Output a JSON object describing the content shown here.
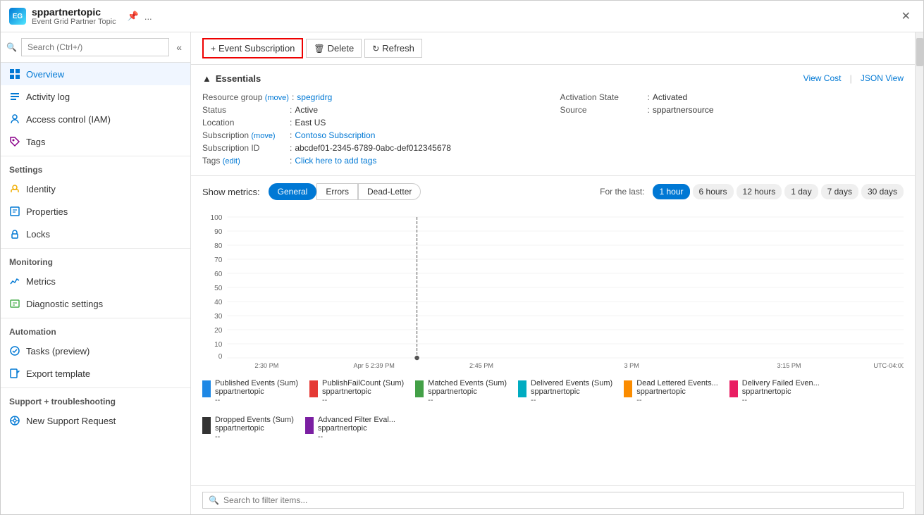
{
  "titleBar": {
    "title": "sppartnertopic",
    "subtitle": "Event Grid Partner Topic",
    "pinIcon": "📌",
    "moreIcon": "...",
    "closeIcon": "✕"
  },
  "sidebar": {
    "searchPlaceholder": "Search (Ctrl+/)",
    "collapseIcon": "«",
    "navItems": [
      {
        "id": "overview",
        "label": "Overview",
        "icon": "overview",
        "active": true
      },
      {
        "id": "activity-log",
        "label": "Activity log",
        "icon": "activity",
        "active": false
      },
      {
        "id": "access-control",
        "label": "Access control (IAM)",
        "icon": "access",
        "active": false
      },
      {
        "id": "tags",
        "label": "Tags",
        "icon": "tags",
        "active": false
      }
    ],
    "sections": [
      {
        "label": "Settings",
        "items": [
          {
            "id": "identity",
            "label": "Identity",
            "icon": "identity"
          },
          {
            "id": "properties",
            "label": "Properties",
            "icon": "properties"
          },
          {
            "id": "locks",
            "label": "Locks",
            "icon": "locks"
          }
        ]
      },
      {
        "label": "Monitoring",
        "items": [
          {
            "id": "metrics",
            "label": "Metrics",
            "icon": "metrics"
          },
          {
            "id": "diagnostic",
            "label": "Diagnostic settings",
            "icon": "diagnostic"
          }
        ]
      },
      {
        "label": "Automation",
        "items": [
          {
            "id": "tasks",
            "label": "Tasks (preview)",
            "icon": "tasks"
          },
          {
            "id": "export",
            "label": "Export template",
            "icon": "export"
          }
        ]
      },
      {
        "label": "Support + troubleshooting",
        "items": [
          {
            "id": "support",
            "label": "New Support Request",
            "icon": "support"
          }
        ]
      }
    ]
  },
  "toolbar": {
    "buttons": [
      {
        "id": "event-subscription",
        "label": "Event Subscription",
        "icon": "+",
        "primary": true
      },
      {
        "id": "delete",
        "label": "Delete",
        "icon": "🗑"
      },
      {
        "id": "refresh",
        "label": "Refresh",
        "icon": "↻"
      }
    ]
  },
  "essentials": {
    "title": "Essentials",
    "chevron": "▲",
    "links": [
      {
        "id": "view-cost",
        "label": "View Cost"
      },
      {
        "id": "json-view",
        "label": "JSON View"
      }
    ],
    "fields": [
      {
        "label": "Resource group",
        "subLabel": "(move)",
        "value": "spegridrg",
        "isLink": true,
        "col": 1
      },
      {
        "label": "Activation State",
        "value": "Activated",
        "isLink": false,
        "col": 2
      },
      {
        "label": "Status",
        "value": "Active",
        "isLink": false,
        "col": 1
      },
      {
        "label": "Source",
        "value": "sppartnersource",
        "isLink": false,
        "col": 2
      },
      {
        "label": "Location",
        "value": "East US",
        "isLink": false,
        "col": 1
      },
      {
        "label": "Subscription",
        "subLabel": "(move)",
        "value": "Contoso Subscription",
        "isLink": true,
        "col": 1
      },
      {
        "label": "Subscription ID",
        "value": "abcdef01-2345-6789-0abc-def012345678",
        "isLink": false,
        "col": 1
      },
      {
        "label": "Tags",
        "subLabel": "(edit)",
        "value": "Click here to add tags",
        "isLink": true,
        "col": 1
      }
    ]
  },
  "metrics": {
    "showMetricsLabel": "Show metrics:",
    "tabs": [
      {
        "id": "general",
        "label": "General",
        "active": true
      },
      {
        "id": "errors",
        "label": "Errors",
        "active": false
      },
      {
        "id": "dead-letter",
        "label": "Dead-Letter",
        "active": false
      }
    ],
    "forTheLastLabel": "For the last:",
    "timeTabs": [
      {
        "id": "1hour",
        "label": "1 hour",
        "active": true
      },
      {
        "id": "6hours",
        "label": "6 hours",
        "active": false
      },
      {
        "id": "12hours",
        "label": "12 hours",
        "active": false
      },
      {
        "id": "1day",
        "label": "1 day",
        "active": false
      },
      {
        "id": "7days",
        "label": "7 days",
        "active": false
      },
      {
        "id": "30days",
        "label": "30 days",
        "active": false
      }
    ],
    "chartYAxis": [
      100,
      90,
      80,
      70,
      60,
      50,
      40,
      30,
      20,
      10,
      0
    ],
    "chartXLabels": [
      "2:30 PM",
      "Apr 5  2:39 PM",
      "2:45 PM",
      "3 PM",
      "3:15 PM",
      "UTC-04:00"
    ],
    "legend": [
      {
        "id": "published-events",
        "label": "Published Events (Sum)",
        "sublabel": "sppartnertopic",
        "value": "--",
        "color": "#1e88e5"
      },
      {
        "id": "publish-fail",
        "label": "PublishFailCount (Sum)",
        "sublabel": "sppartnertopic",
        "value": "--",
        "color": "#e53935"
      },
      {
        "id": "matched-events",
        "label": "Matched Events (Sum)",
        "sublabel": "sppartnertopic",
        "value": "--",
        "color": "#43a047"
      },
      {
        "id": "delivered-events",
        "label": "Delivered Events (Sum)",
        "sublabel": "sppartnertopic",
        "value": "--",
        "color": "#00acc1"
      },
      {
        "id": "dead-lettered",
        "label": "Dead Lettered Events...",
        "sublabel": "sppartnertopic",
        "value": "--",
        "color": "#fb8c00"
      },
      {
        "id": "delivery-failed",
        "label": "Delivery Failed Even...",
        "sublabel": "sppartnertopic",
        "value": "--",
        "color": "#e91e63"
      },
      {
        "id": "dropped-events",
        "label": "Dropped Events (Sum)",
        "sublabel": "sppartnertopic",
        "value": "--",
        "color": "#333333"
      },
      {
        "id": "advanced-filter",
        "label": "Advanced Filter Eval...",
        "sublabel": "sppartnertopic",
        "value": "--",
        "color": "#7b1fa2"
      }
    ]
  },
  "bottomSearch": {
    "placeholder": "Search to filter items..."
  }
}
